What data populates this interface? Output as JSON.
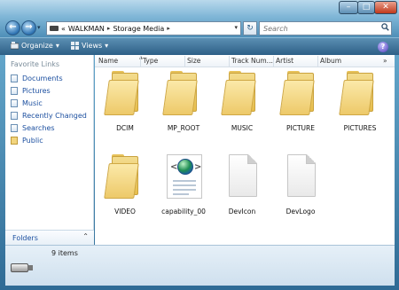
{
  "titlebar": {
    "min_glyph": "–",
    "max_glyph": "□",
    "close_glyph": "✕"
  },
  "nav": {
    "back_glyph": "←",
    "forward_glyph": "→",
    "recent_glyph": "▾"
  },
  "address": {
    "prefix": "«",
    "crumbs": [
      "WALKMAN",
      "Storage Media"
    ],
    "separator": "▸",
    "dropdown_glyph": "▾"
  },
  "refresh_glyph": "↻",
  "search": {
    "placeholder": "Search",
    "icon": "search-icon"
  },
  "commandbar": {
    "organize": "Organize",
    "views": "Views",
    "dropdown_glyph": "▾",
    "help": "?"
  },
  "navpane": {
    "favorites_title": "Favorite Links",
    "items": [
      {
        "label": "Documents",
        "icon": "document-icon"
      },
      {
        "label": "Pictures",
        "icon": "pictures-icon"
      },
      {
        "label": "Music",
        "icon": "music-icon"
      },
      {
        "label": "Recently Changed",
        "icon": "recent-icon"
      },
      {
        "label": "Searches",
        "icon": "searches-icon"
      },
      {
        "label": "Public",
        "icon": "folder-icon"
      }
    ],
    "folders_label": "Folders",
    "folders_chevron": "⌃"
  },
  "columns": [
    "Name",
    "Type",
    "Size",
    "Track Num...",
    "Artist",
    "Album"
  ],
  "columns_more": "»",
  "sort_indicator": "▲",
  "files": [
    {
      "name": "DCIM",
      "kind": "folder"
    },
    {
      "name": "MP_ROOT",
      "kind": "folder"
    },
    {
      "name": "MUSIC",
      "kind": "folder"
    },
    {
      "name": "PICTURE",
      "kind": "folder"
    },
    {
      "name": "PICTURES",
      "kind": "folder"
    },
    {
      "name": "VIDEO",
      "kind": "folder"
    },
    {
      "name": "capability_00",
      "kind": "xml"
    },
    {
      "name": "DevIcon",
      "kind": "file"
    },
    {
      "name": "DevLogo",
      "kind": "file"
    }
  ],
  "details": {
    "count": "9 items"
  },
  "colors": {
    "accent": "#1d50a0",
    "frame": "#4f8fb8"
  }
}
